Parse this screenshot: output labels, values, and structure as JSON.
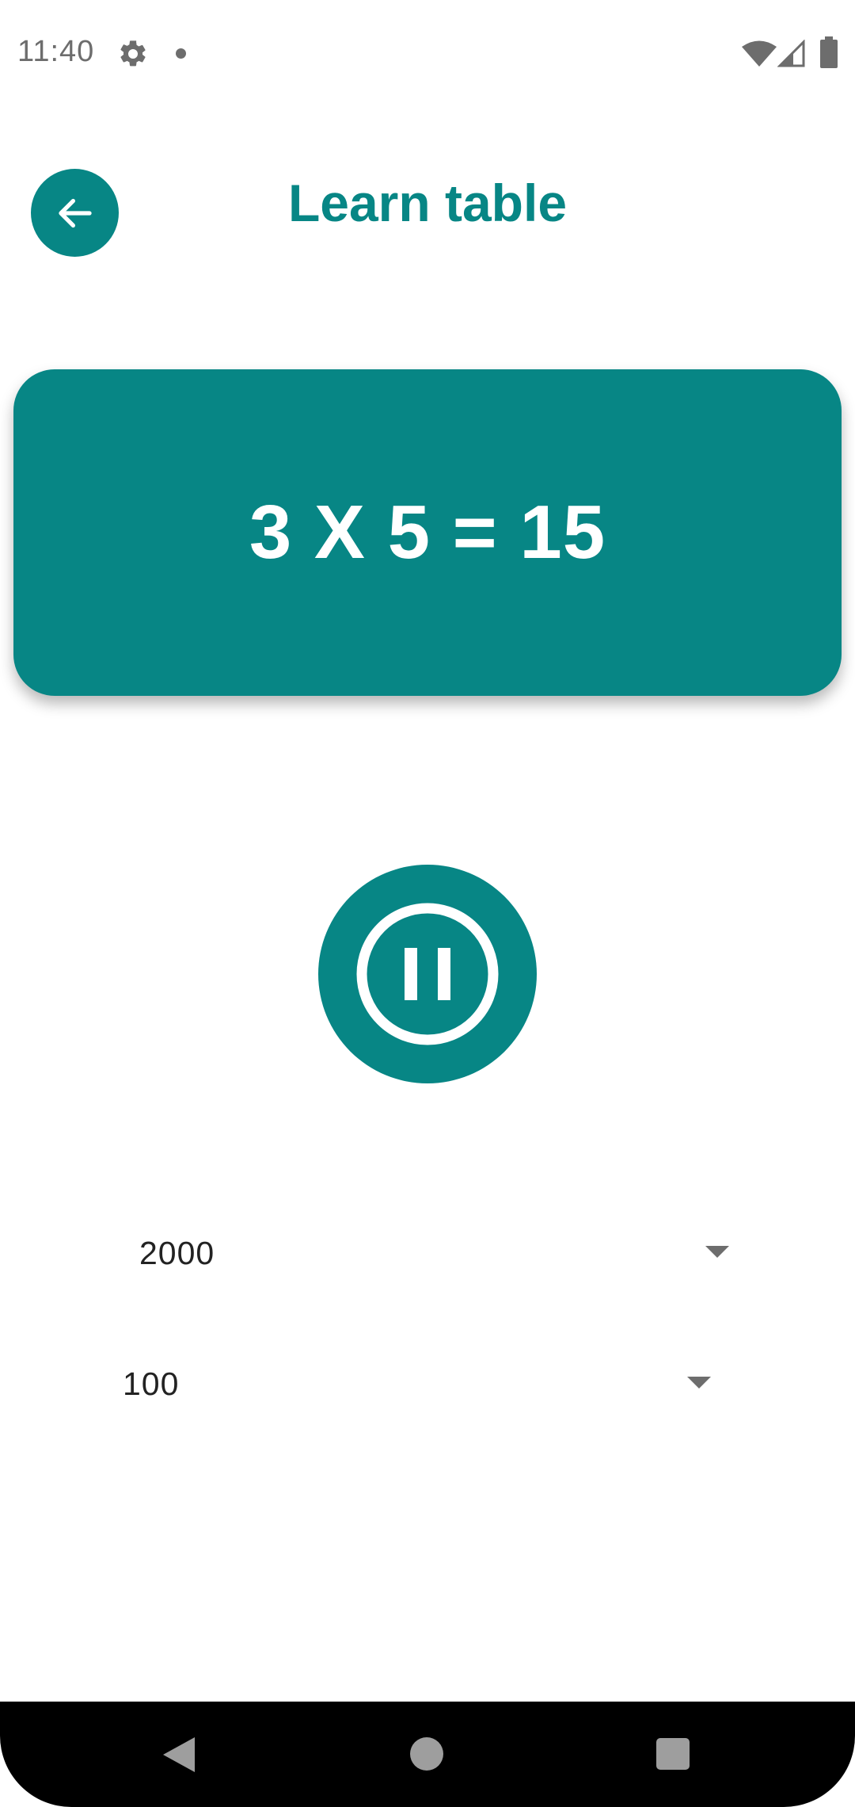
{
  "status_bar": {
    "time": "11:40",
    "icons": [
      "gear-icon",
      "notification-dot-icon",
      "wifi-icon",
      "signal-icon",
      "battery-icon"
    ]
  },
  "header": {
    "title": "Learn table",
    "back_icon": "arrow-left-icon"
  },
  "equation": {
    "text": "3 X 5 = 15"
  },
  "controls": {
    "pause_icon": "pause-circle-icon"
  },
  "dropdowns": {
    "speed": {
      "value": "2000"
    },
    "count": {
      "value": "100"
    }
  },
  "navigation": {
    "icons": [
      "nav-back-icon",
      "nav-home-icon",
      "nav-recents-icon"
    ]
  },
  "colors": {
    "accent": "#078685",
    "text_dark": "#222222",
    "icon_grey": "#6d6d6d",
    "nav_background": "#000000",
    "nav_icon": "#9e9e9e"
  }
}
